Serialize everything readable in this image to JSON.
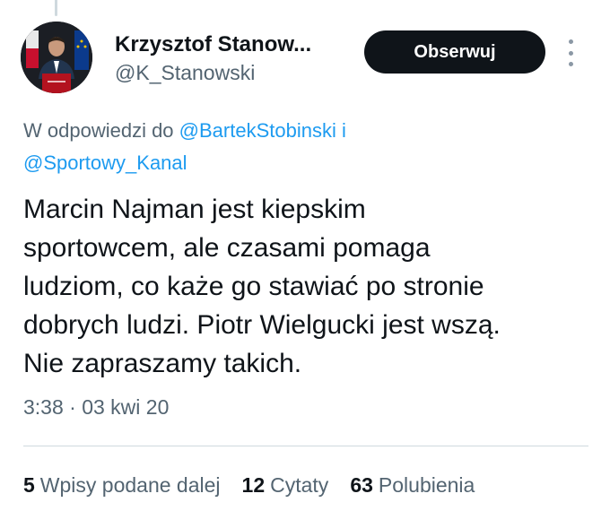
{
  "author": {
    "name": "Krzysztof Stanow...",
    "handle": "@K_Stanowski"
  },
  "follow_button": {
    "label": "Obserwuj"
  },
  "more_icon": "more-vertical-icon",
  "reply": {
    "prefix": "W odpowiedzi do",
    "mention_1": "@BartekStobinski",
    "joiner": "i",
    "mention_2": "@Sportowy_Kanal"
  },
  "tweet": {
    "lines": [
      "Marcin Najman jest kiepskim",
      "sportowcem, ale czasami pomaga",
      "ludziom, co każe go stawiać po stronie",
      "dobrych ludzi. Piotr Wielgucki jest wszą.",
      "Nie zapraszamy takich."
    ]
  },
  "timestamp": "3:38 · 03 kwi 20",
  "stats": {
    "retweets": {
      "count": "5",
      "label": "Wpisy podane dalej"
    },
    "quotes": {
      "count": "12",
      "label": "Cytaty"
    },
    "likes": {
      "count": "63",
      "label": "Polubienia"
    }
  },
  "colors": {
    "link": "#1d9bf0",
    "secondary_text": "#536471",
    "primary_text": "#0f1419",
    "button_bg": "#0f1419"
  }
}
